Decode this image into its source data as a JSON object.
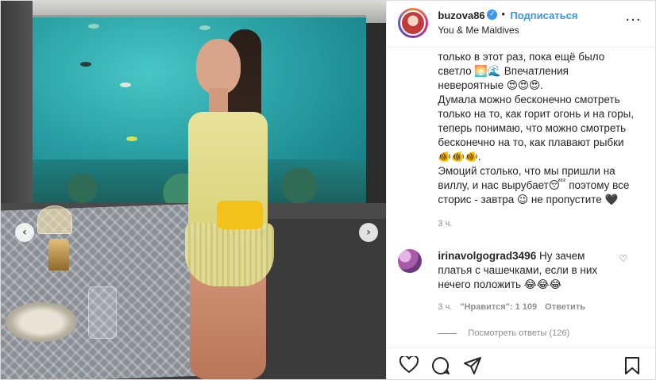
{
  "post": {
    "username": "buzova86",
    "verified_mark": "✓",
    "separator": "•",
    "follow_label": "Подписаться",
    "location": "You & Me Maldives",
    "more_label": "···"
  },
  "carousel": {
    "prev_label": "‹",
    "next_label": "›"
  },
  "caption": {
    "text": "только в этот раз, пока ещё было светло 🌅🌊 Впечатления невероятные 😍😍😍.\nДумала можно бесконечно смотреть только на то, как горит огонь и на горы, теперь понимаю, что можно смотреть бесконечно на то, как плавают рыбки 🐠🐠🐠.\nЭмоций столько, что мы пришли на виллу, и нас вырубает😴 поэтому все сторис - завтра 😉 не пропустите 🖤",
    "time": "3 ч."
  },
  "comment": {
    "username": "irinavolgograd3496",
    "text": "Ну зачем платья с чашечками, если в них нечего положить 😂😂😂",
    "time": "3 ч.",
    "likes": "\"Нравится\": 1 109",
    "reply_label": "Ответить",
    "view_replies": "Посмотреть ответы (126)"
  },
  "icons": {
    "like": "heart-icon",
    "comment": "comment-icon",
    "share": "share-icon",
    "save": "bookmark-icon",
    "comment_like": "small-heart-icon"
  },
  "colors": {
    "link": "#3897f0",
    "text": "#262626",
    "muted": "#8e8e8e"
  }
}
